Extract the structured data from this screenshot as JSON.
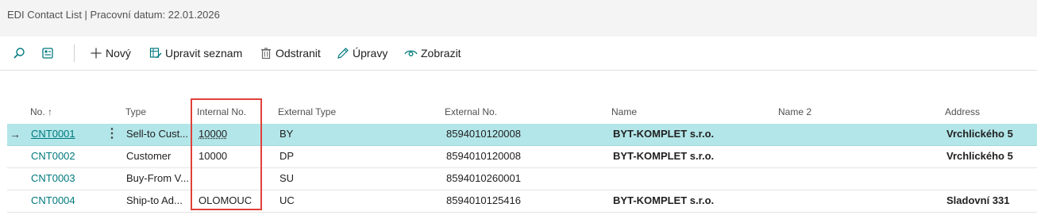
{
  "page": {
    "title": "EDI Contact List | Pracovní datum: 22.01.2026"
  },
  "toolbar": {
    "search_icon": "search-icon",
    "layout_icon": "layout-icon",
    "new_label": "Nový",
    "edit_list_label": "Upravit seznam",
    "delete_label": "Odstranit",
    "edit_label": "Úpravy",
    "view_label": "Zobrazit"
  },
  "columns": {
    "no": "No. ↑",
    "type": "Type",
    "internal_no": "Internal No.",
    "external_type": "External Type",
    "external_no": "External No.",
    "name": "Name",
    "name2": "Name 2",
    "address": "Address"
  },
  "rows": [
    {
      "no": "CNT0001",
      "type": "Sell-to Cust...",
      "internal_no": "10000",
      "external_type": "BY",
      "external_no": "8594010120008",
      "name": "BYT-KOMPLET s.r.o.",
      "name2": "",
      "address": "Vrchlického 5"
    },
    {
      "no": "CNT0002",
      "type": "Customer",
      "internal_no": "10000",
      "external_type": "DP",
      "external_no": "8594010120008",
      "name": "BYT-KOMPLET s.r.o.",
      "name2": "",
      "address": "Vrchlického 5"
    },
    {
      "no": "CNT0003",
      "type": "Buy-From V...",
      "internal_no": "",
      "external_type": "SU",
      "external_no": "8594010260001",
      "name": "",
      "name2": "",
      "address": ""
    },
    {
      "no": "CNT0004",
      "type": "Ship-to Ad...",
      "internal_no": "OLOMOUC",
      "external_type": "UC",
      "external_no": "8594010125416",
      "name": "BYT-KOMPLET s.r.o.",
      "name2": "",
      "address": "Sladovní 331"
    }
  ],
  "colors": {
    "accent": "#00797e",
    "selected_row": "#b3e6e9",
    "highlight_box": "#e0403a"
  }
}
